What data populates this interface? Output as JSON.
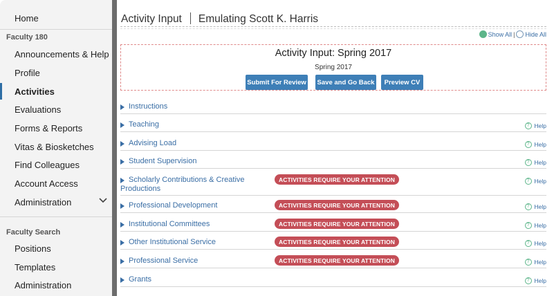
{
  "sidebar": {
    "home": "Home",
    "section1": "Faculty 180",
    "items": [
      "Announcements & Help",
      "Profile",
      "Activities",
      "Evaluations",
      "Forms & Reports",
      "Vitas & Biosketches",
      "Find Colleagues",
      "Account Access",
      "Administration"
    ],
    "section2": "Faculty Search",
    "items2": [
      "Positions",
      "Templates",
      "Administration"
    ]
  },
  "header": {
    "title": "Activity Input",
    "emulating": "Emulating Scott K. Harris",
    "show_all": "Show All",
    "hide_all": "Hide All"
  },
  "box": {
    "title": "Activity Input: Spring 2017",
    "subtitle": "Spring 2017",
    "buttons": [
      "Submit For Review",
      "Save and Go Back",
      "Preview CV"
    ]
  },
  "sections": [
    {
      "label": "Instructions",
      "badge": "",
      "help": ""
    },
    {
      "label": "Teaching",
      "badge": "",
      "help": "Help"
    },
    {
      "label": "Advising Load",
      "badge": "",
      "help": "Help"
    },
    {
      "label": "Student Supervision",
      "badge": "",
      "help": "Help"
    },
    {
      "label": "Scholarly Contributions & Creative",
      "label2": "Productions",
      "badge": "ACTIVITIES REQUIRE YOUR ATTENTION",
      "help": "Help"
    },
    {
      "label": "Professional Development",
      "badge": "ACTIVITIES REQUIRE YOUR ATTENTION",
      "help": "Help"
    },
    {
      "label": "Institutional Committees",
      "badge": "ACTIVITIES REQUIRE YOUR ATTENTION",
      "help": "Help"
    },
    {
      "label": "Other Institutional Service",
      "badge": "ACTIVITIES REQUIRE YOUR ATTENTION",
      "help": "Help"
    },
    {
      "label": "Professional Service",
      "badge": "ACTIVITIES REQUIRE YOUR ATTENTION",
      "help": "Help"
    },
    {
      "label": "Grants",
      "badge": "",
      "help": "Help"
    }
  ],
  "colors": {
    "accent": "#3e7fb7",
    "badge": "#c44e57",
    "link": "#3a6ea5"
  }
}
